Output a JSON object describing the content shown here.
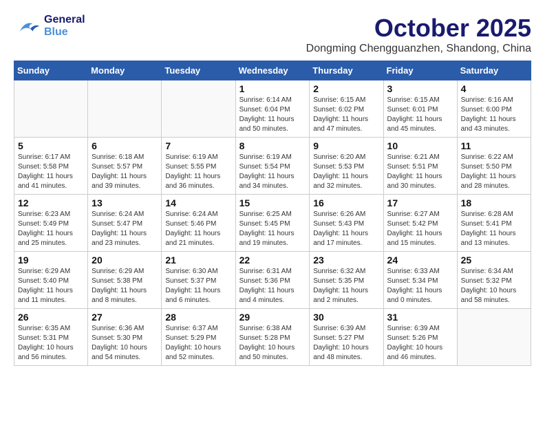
{
  "header": {
    "logo_general": "General",
    "logo_blue": "Blue",
    "month_title": "October 2025",
    "location": "Dongming Chengguanzhen, Shandong, China"
  },
  "weekdays": [
    "Sunday",
    "Monday",
    "Tuesday",
    "Wednesday",
    "Thursday",
    "Friday",
    "Saturday"
  ],
  "weeks": [
    [
      {
        "day": "",
        "info": ""
      },
      {
        "day": "",
        "info": ""
      },
      {
        "day": "",
        "info": ""
      },
      {
        "day": "1",
        "info": "Sunrise: 6:14 AM\nSunset: 6:04 PM\nDaylight: 11 hours\nand 50 minutes."
      },
      {
        "day": "2",
        "info": "Sunrise: 6:15 AM\nSunset: 6:02 PM\nDaylight: 11 hours\nand 47 minutes."
      },
      {
        "day": "3",
        "info": "Sunrise: 6:15 AM\nSunset: 6:01 PM\nDaylight: 11 hours\nand 45 minutes."
      },
      {
        "day": "4",
        "info": "Sunrise: 6:16 AM\nSunset: 6:00 PM\nDaylight: 11 hours\nand 43 minutes."
      }
    ],
    [
      {
        "day": "5",
        "info": "Sunrise: 6:17 AM\nSunset: 5:58 PM\nDaylight: 11 hours\nand 41 minutes."
      },
      {
        "day": "6",
        "info": "Sunrise: 6:18 AM\nSunset: 5:57 PM\nDaylight: 11 hours\nand 39 minutes."
      },
      {
        "day": "7",
        "info": "Sunrise: 6:19 AM\nSunset: 5:55 PM\nDaylight: 11 hours\nand 36 minutes."
      },
      {
        "day": "8",
        "info": "Sunrise: 6:19 AM\nSunset: 5:54 PM\nDaylight: 11 hours\nand 34 minutes."
      },
      {
        "day": "9",
        "info": "Sunrise: 6:20 AM\nSunset: 5:53 PM\nDaylight: 11 hours\nand 32 minutes."
      },
      {
        "day": "10",
        "info": "Sunrise: 6:21 AM\nSunset: 5:51 PM\nDaylight: 11 hours\nand 30 minutes."
      },
      {
        "day": "11",
        "info": "Sunrise: 6:22 AM\nSunset: 5:50 PM\nDaylight: 11 hours\nand 28 minutes."
      }
    ],
    [
      {
        "day": "12",
        "info": "Sunrise: 6:23 AM\nSunset: 5:49 PM\nDaylight: 11 hours\nand 25 minutes."
      },
      {
        "day": "13",
        "info": "Sunrise: 6:24 AM\nSunset: 5:47 PM\nDaylight: 11 hours\nand 23 minutes."
      },
      {
        "day": "14",
        "info": "Sunrise: 6:24 AM\nSunset: 5:46 PM\nDaylight: 11 hours\nand 21 minutes."
      },
      {
        "day": "15",
        "info": "Sunrise: 6:25 AM\nSunset: 5:45 PM\nDaylight: 11 hours\nand 19 minutes."
      },
      {
        "day": "16",
        "info": "Sunrise: 6:26 AM\nSunset: 5:43 PM\nDaylight: 11 hours\nand 17 minutes."
      },
      {
        "day": "17",
        "info": "Sunrise: 6:27 AM\nSunset: 5:42 PM\nDaylight: 11 hours\nand 15 minutes."
      },
      {
        "day": "18",
        "info": "Sunrise: 6:28 AM\nSunset: 5:41 PM\nDaylight: 11 hours\nand 13 minutes."
      }
    ],
    [
      {
        "day": "19",
        "info": "Sunrise: 6:29 AM\nSunset: 5:40 PM\nDaylight: 11 hours\nand 11 minutes."
      },
      {
        "day": "20",
        "info": "Sunrise: 6:29 AM\nSunset: 5:38 PM\nDaylight: 11 hours\nand 8 minutes."
      },
      {
        "day": "21",
        "info": "Sunrise: 6:30 AM\nSunset: 5:37 PM\nDaylight: 11 hours\nand 6 minutes."
      },
      {
        "day": "22",
        "info": "Sunrise: 6:31 AM\nSunset: 5:36 PM\nDaylight: 11 hours\nand 4 minutes."
      },
      {
        "day": "23",
        "info": "Sunrise: 6:32 AM\nSunset: 5:35 PM\nDaylight: 11 hours\nand 2 minutes."
      },
      {
        "day": "24",
        "info": "Sunrise: 6:33 AM\nSunset: 5:34 PM\nDaylight: 11 hours\nand 0 minutes."
      },
      {
        "day": "25",
        "info": "Sunrise: 6:34 AM\nSunset: 5:32 PM\nDaylight: 10 hours\nand 58 minutes."
      }
    ],
    [
      {
        "day": "26",
        "info": "Sunrise: 6:35 AM\nSunset: 5:31 PM\nDaylight: 10 hours\nand 56 minutes."
      },
      {
        "day": "27",
        "info": "Sunrise: 6:36 AM\nSunset: 5:30 PM\nDaylight: 10 hours\nand 54 minutes."
      },
      {
        "day": "28",
        "info": "Sunrise: 6:37 AM\nSunset: 5:29 PM\nDaylight: 10 hours\nand 52 minutes."
      },
      {
        "day": "29",
        "info": "Sunrise: 6:38 AM\nSunset: 5:28 PM\nDaylight: 10 hours\nand 50 minutes."
      },
      {
        "day": "30",
        "info": "Sunrise: 6:39 AM\nSunset: 5:27 PM\nDaylight: 10 hours\nand 48 minutes."
      },
      {
        "day": "31",
        "info": "Sunrise: 6:39 AM\nSunset: 5:26 PM\nDaylight: 10 hours\nand 46 minutes."
      },
      {
        "day": "",
        "info": ""
      }
    ]
  ]
}
